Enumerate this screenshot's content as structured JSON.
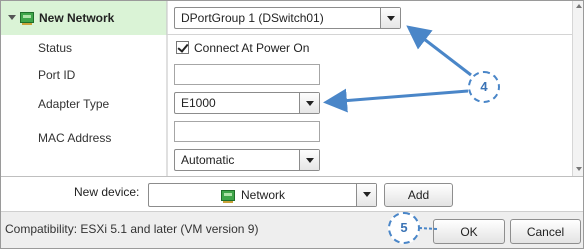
{
  "header": {
    "title": "New Network",
    "network_value": "DPortGroup 1 (DSwitch01)"
  },
  "properties": [
    {
      "key": "status",
      "label": "Status",
      "value": "Connect At Power On"
    },
    {
      "key": "port_id",
      "label": "Port ID",
      "value": ""
    },
    {
      "key": "adapter_type",
      "label": "Adapter Type",
      "value": "E1000"
    },
    {
      "key": "mac_address",
      "label": "MAC Address",
      "value": "",
      "mode": "Automatic"
    }
  ],
  "device": {
    "label": "New device:",
    "selected": "Network",
    "add_label": "Add"
  },
  "footer": {
    "compatibility": "Compatibility: ESXi 5.1 and later (VM version 9)",
    "ok_label": "OK",
    "cancel_label": "Cancel"
  },
  "annotations": [
    {
      "number": "4"
    },
    {
      "number": "5"
    }
  ],
  "icons": {
    "expand": "triangle-down-icon",
    "network": "network-adapter-icon",
    "dropdown": "chevron-down-icon"
  },
  "colors": {
    "selected_row": "#daf3d6",
    "annotation": "#4a86c8"
  }
}
